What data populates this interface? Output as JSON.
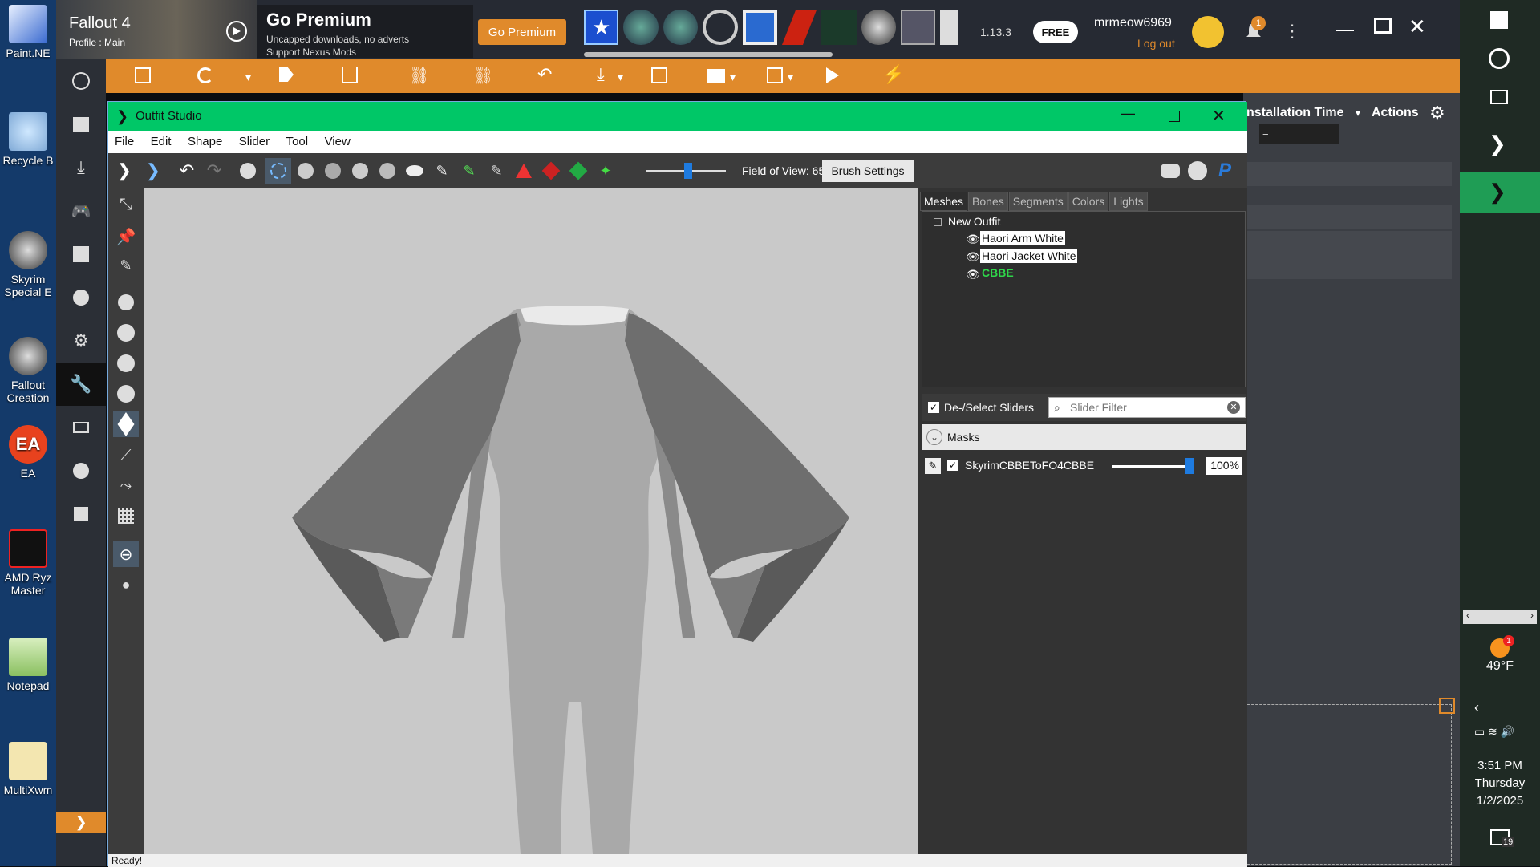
{
  "desktop": {
    "icons": [
      {
        "label": "Paint.NE",
        "icon": "paint-icon"
      },
      {
        "label": "Recycle B",
        "icon": "recycle-bin-icon"
      },
      {
        "label": "Skyrim Special E",
        "icon": "creation-kit-icon"
      },
      {
        "label": "Fallout Creation",
        "icon": "creation-kit-icon"
      },
      {
        "label": "EA",
        "icon": "ea-icon"
      },
      {
        "label": "AMD Ryz Master",
        "icon": "amd-ryzen-icon"
      },
      {
        "label": "Notepad",
        "icon": "notepad-icon"
      },
      {
        "label": "MultiXwm",
        "icon": "folder-icon"
      }
    ]
  },
  "vortex": {
    "game": "Fallout 4",
    "profile": "Profile : Main",
    "premium_title": "Go Premium",
    "premium_line1": "Uncapped downloads, no adverts",
    "premium_line2": "Support Nexus Mods",
    "premium_button": "Go Premium",
    "version": "1.13.3",
    "plan_badge": "FREE",
    "username": "mrmeow6969",
    "logout": "Log out",
    "notification_count": "1",
    "right_header_col": "nstallation Time",
    "right_actions": "Actions",
    "right_filter_value": "="
  },
  "outfit_studio": {
    "title": "Outfit Studio",
    "menu": [
      "File",
      "Edit",
      "Shape",
      "Slider",
      "Tool",
      "View"
    ],
    "fov_label": "Field of View: 65",
    "brush_settings": "Brush Settings",
    "tabs": [
      "Meshes",
      "Bones",
      "Segments",
      "Colors",
      "Lights"
    ],
    "tree_root": "New Outfit",
    "meshes": [
      {
        "name": "Haori Arm White",
        "highlight": false
      },
      {
        "name": "Haori Jacket White",
        "highlight": false
      },
      {
        "name": "CBBE",
        "highlight": true
      }
    ],
    "deselect_label": "De-/Select Sliders",
    "slider_filter_placeholder": "Slider Filter",
    "masks_label": "Masks",
    "slider_name": "SkyrimCBBEToFO4CBBE",
    "slider_value": "100%",
    "slider_fraction": 1.0,
    "status": "Ready!"
  },
  "taskbar": {
    "temperature": "49°F",
    "weather_badge": "1",
    "time": "3:51 PM",
    "day": "Thursday",
    "date": "1/2/2025",
    "notifications": "19"
  },
  "colors": {
    "vortex_orange": "#e08a2b",
    "outfit_studio_green": "#00c767",
    "cbbe_green": "#2fd64a"
  }
}
